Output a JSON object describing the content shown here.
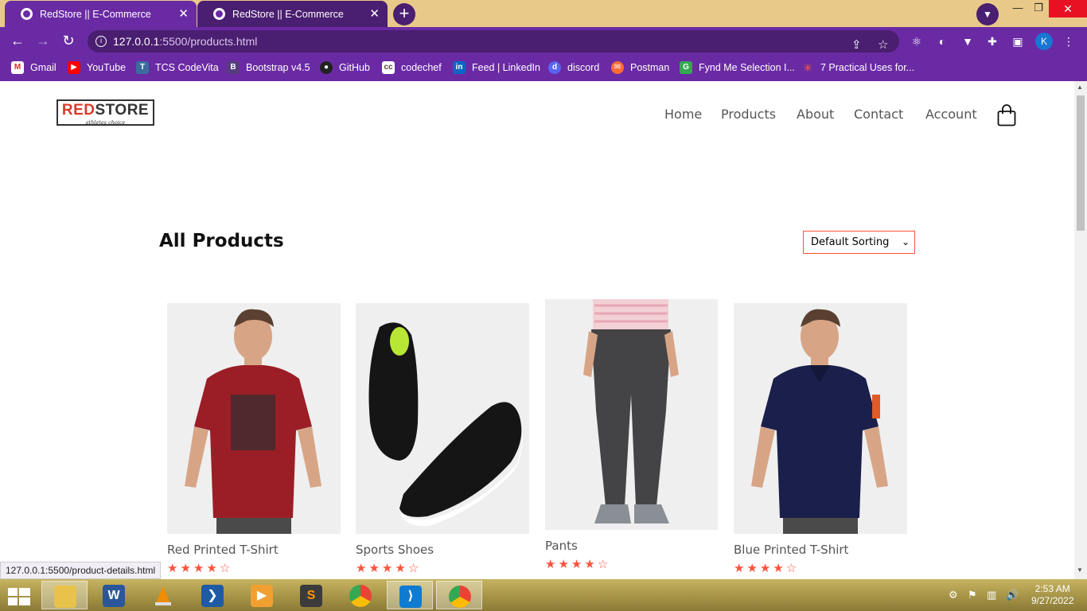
{
  "browser": {
    "tabs": [
      {
        "title": "RedStore || E-Commerce",
        "active": true
      },
      {
        "title": "RedStore || E-Commerce",
        "active": false
      }
    ],
    "url_host": "127.0.0.1",
    "url_path": ":5500/products.html",
    "profile_initial": "K",
    "bookmarks": [
      "Gmail",
      "YouTube",
      "TCS CodeVita",
      "Bootstrap v4.5",
      "GitHub",
      "codechef",
      "Feed | LinkedIn",
      "discord",
      "Postman",
      "Fynd Me Selection I...",
      "7 Practical Uses for..."
    ],
    "status_url": "127.0.0.1:5500/product-details.html"
  },
  "site": {
    "logo_main_red": "RED",
    "logo_main_dark": "STORE",
    "logo_tagline": "athletes choice",
    "nav": [
      "Home",
      "Products",
      "About",
      "Contact",
      "Account"
    ]
  },
  "main": {
    "title": "All Products",
    "sort_selected": "Default Sorting",
    "products": [
      {
        "name": "Red Printed T-Shirt",
        "rating": 4
      },
      {
        "name": "Sports Shoes",
        "rating": 4
      },
      {
        "name": "Pants",
        "rating": 4
      },
      {
        "name": "Blue Printed T-Shirt",
        "rating": 4
      }
    ]
  },
  "taskbar": {
    "time": "2:53 AM",
    "date": "9/27/2022"
  },
  "colors": {
    "accent": "#ff523b",
    "browser_purple": "#6a2aa4"
  }
}
